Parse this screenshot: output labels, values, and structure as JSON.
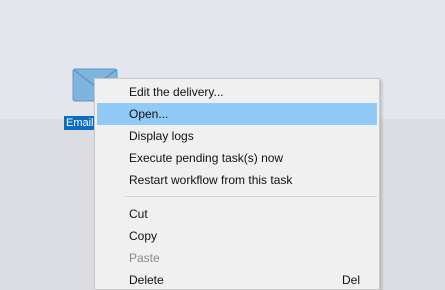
{
  "canvas": {
    "node_label": "Email d",
    "node_icon": "email-envelope-icon"
  },
  "context_menu": {
    "items": [
      {
        "label": "Edit the delivery...",
        "state": "normal"
      },
      {
        "label": "Open...",
        "state": "hover"
      },
      {
        "label": "Display logs",
        "state": "normal"
      },
      {
        "label": "Execute pending task(s) now",
        "state": "normal"
      },
      {
        "label": "Restart workflow from this task",
        "state": "normal"
      },
      {
        "label": "Cut",
        "state": "normal"
      },
      {
        "label": "Copy",
        "state": "normal"
      },
      {
        "label": "Paste",
        "state": "disabled"
      },
      {
        "label": "Delete",
        "state": "normal",
        "shortcut": "Del"
      }
    ]
  },
  "colors": {
    "hover_highlight": "#91c9f7",
    "selection_label": "#0a6cc4",
    "envelope": "#7fb4de"
  }
}
